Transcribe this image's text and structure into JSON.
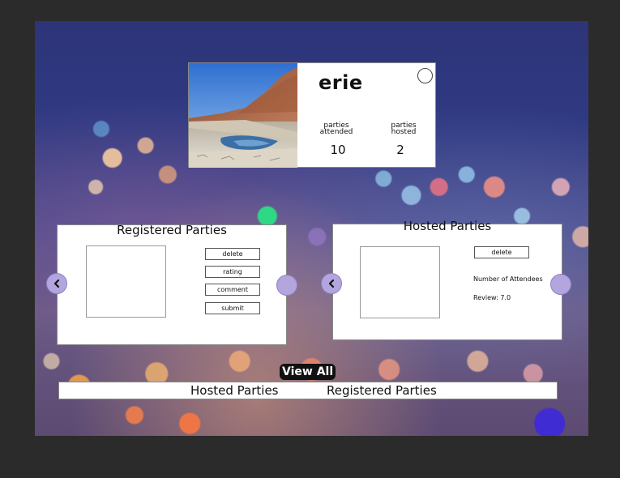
{
  "profile": {
    "username": "erie",
    "parties_attended_label": "parties attended",
    "parties_hosted_label": "parties hosted",
    "parties_attended": "10",
    "parties_hosted": "2"
  },
  "registered_panel": {
    "title": "Registered Parties",
    "buttons": [
      "delete",
      "rating",
      "comment",
      "submit"
    ]
  },
  "hosted_panel": {
    "title": "Hosted Parties",
    "delete_label": "delete",
    "attendees_label": "Number of Attendees",
    "review_label": "Review: 7.0"
  },
  "view_all_label": "View All",
  "bottom_nav": {
    "hosted": "Hosted Parties",
    "registered": "Registered Parties"
  },
  "colors": {
    "nav_circle": "#b3a6df",
    "background_top": "#2d3478"
  },
  "icons": [
    "chevron-left-icon"
  ]
}
